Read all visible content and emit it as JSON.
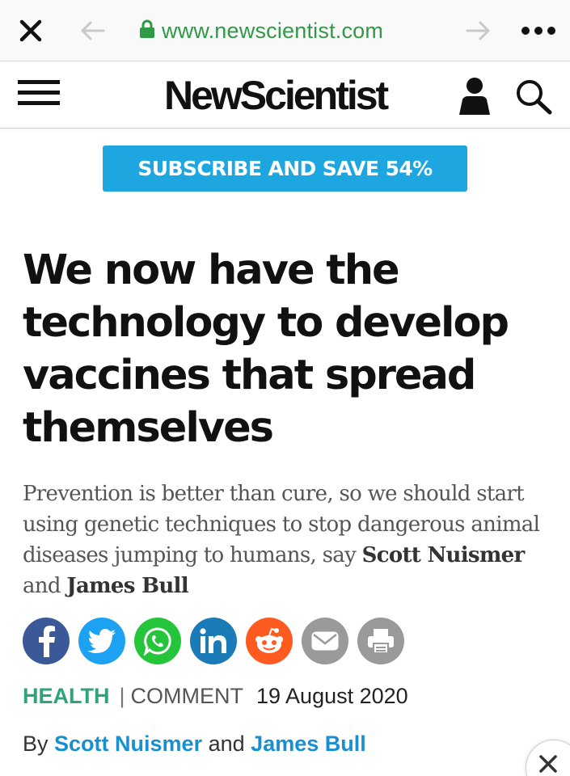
{
  "browser": {
    "url": "www.newscientist.com",
    "icons": {
      "close": "close-icon",
      "back": "back-arrow-icon",
      "lock": "lock-icon",
      "forward": "forward-arrow-icon",
      "more": "more-icon"
    }
  },
  "header": {
    "logo": "NewScientist",
    "icons": {
      "menu": "menu-icon",
      "user": "user-icon",
      "search": "search-icon"
    }
  },
  "subscribe": {
    "label": "SUBSCRIBE AND SAVE 54%",
    "color": "#1da6e0"
  },
  "article": {
    "headline": "We now have the technology to develop vaccines that spread themselves",
    "standfirst": {
      "text": "Prevention is better than cure, so we should start using genetic techniques to stop dangerous animal diseases jumping to humans, say",
      "author1": "Scott Nuismer",
      "joiner": "and",
      "author2": "James Bull"
    },
    "share": [
      {
        "name": "facebook",
        "icon": "facebook-icon",
        "color": "#3b5998"
      },
      {
        "name": "twitter",
        "icon": "twitter-icon",
        "color": "#1da1f2"
      },
      {
        "name": "whatsapp",
        "icon": "whatsapp-icon",
        "color": "#25c53b"
      },
      {
        "name": "linkedin",
        "icon": "linkedin-icon",
        "color": "#1b7bb7"
      },
      {
        "name": "reddit",
        "icon": "reddit-icon",
        "color": "#ff5a1f"
      },
      {
        "name": "email",
        "icon": "email-icon",
        "color": "#9a9a9a"
      },
      {
        "name": "print",
        "icon": "print-icon",
        "color": "#9a9a9a"
      }
    ],
    "meta": {
      "category": "HEALTH",
      "separator": "|",
      "type": "COMMENT",
      "date": "19 August 2020"
    },
    "byline": {
      "prefix": "By",
      "author1": "Scott Nuismer",
      "joiner": "and",
      "author2": "James Bull"
    }
  },
  "overlay": {
    "close_icon": "close-icon"
  },
  "colors": {
    "url_green": "#2f9a45",
    "category_green": "#2fa37a",
    "author_blue": "#1a8fd0"
  }
}
